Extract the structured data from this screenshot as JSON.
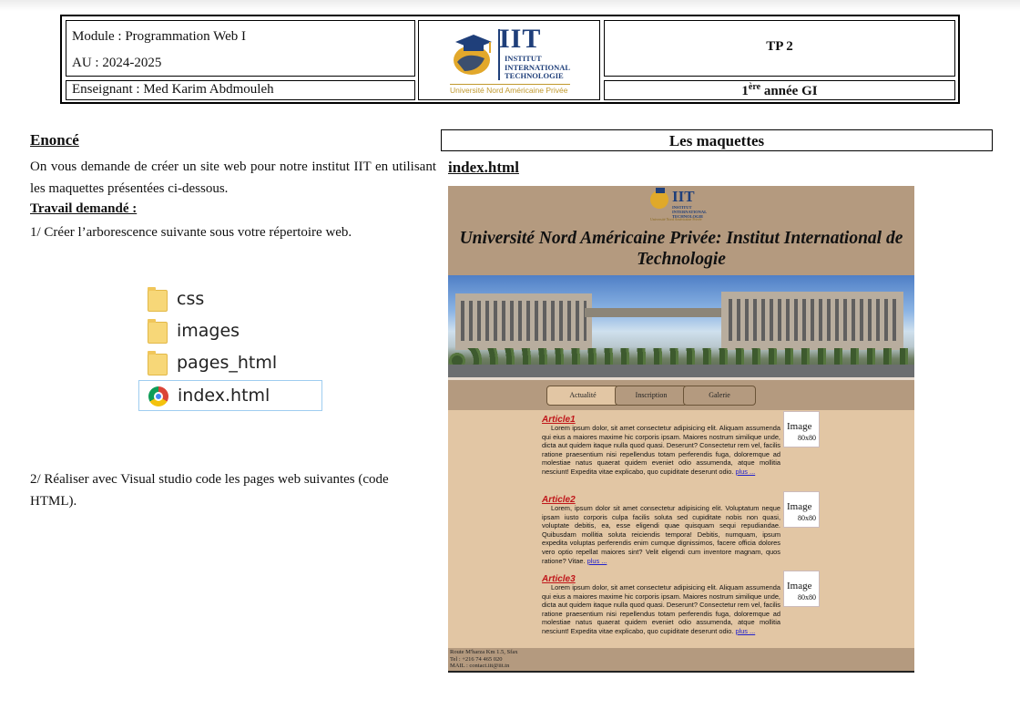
{
  "header": {
    "module": "Module : Programmation Web I",
    "au": "AU : 2024-2025",
    "enseignant": "Enseignant : Med Karim Abdmouleh",
    "tp": "TP 2",
    "annee_num": "1",
    "annee_sup": "ère",
    "annee_rest": " année GI",
    "logo": {
      "acronym": "IIT",
      "line1": "INSTITUT",
      "line2": "INTERNATIONAL",
      "line3": "TECHNOLOGIE",
      "university": "Université Nord Américaine Privée"
    }
  },
  "enonce": {
    "title": "Enoncé",
    "text": "On vous demande de créer un site web pour notre institut IIT en utilisant les maquettes présentées ci-dessous.",
    "travail_title": "Travail demandé :",
    "step1": "1/ Créer l’arborescence suivante sous votre répertoire web.",
    "step2": "2/ Réaliser avec Visual studio code les pages web suivantes (code HTML)."
  },
  "tree": [
    {
      "label": "css",
      "icon": "folder-icon"
    },
    {
      "label": "images",
      "icon": "folder-icon"
    },
    {
      "label": "pages_html",
      "icon": "folder-icon"
    },
    {
      "label": "index.html",
      "icon": "chrome-icon"
    }
  ],
  "maquettes": {
    "title": "Les maquettes",
    "file_label": "index.html"
  },
  "mockup": {
    "logo_acronym": "IIT",
    "logo_sub1": "INSTITUT",
    "logo_sub2": "INTERNATIONAL",
    "logo_sub3": "TECHNOLOGIE",
    "logo_univ": "Université Nord Américaine Privée",
    "title": "Université Nord Américaine Privée: Institut International de Technologie",
    "nav": [
      "Actualité",
      "Inscription",
      "Galerie"
    ],
    "articles": [
      {
        "title": "Article1",
        "body": "Lorem ipsum dolor, sit amet consectetur adipisicing elit. Aliquam assumenda qui eius a maiores maxime hic corporis ipsam. Maiores nostrum similique unde, dicta aut quidem itaque nulla quod quasi. Deserunt? Consectetur rem vel, facilis ratione praesentium nisi repellendus totam perferendis fuga, doloremque ad molestiae natus quaerat quidem eveniet odio assumenda, atque mollitia nesciunt! Expedita vitae explicabo, quo cupiditate deserunt odio.",
        "more": "plus ..."
      },
      {
        "title": "Article2",
        "body": "Lorem, ipsum dolor sit amet consectetur adipisicing elit. Voluptatum neque ipsam iusto corporis culpa facilis soluta sed cupiditate nobis non quasi, voluptate debitis, ea, esse eligendi quae quisquam sequi repudiandae. Quibusdam mollitia soluta reiciendis tempora! Debitis, numquam, ipsum expedita voluptas perferendis enim cumque dignissimos, facere officia dolores vero optio repellat maiores sint? Velit eligendi cum inventore magnam, quos ratione? Vitae.",
        "more": "plus ..."
      },
      {
        "title": "Article3",
        "body": "Lorem ipsum dolor, sit amet consectetur adipisicing elit. Aliquam assumenda qui eius a maiores maxime hic corporis ipsam. Maiores nostrum similique unde, dicta aut quidem itaque nulla quod quasi. Deserunt? Consectetur rem vel, facilis ratione praesentium nisi repellendus totam perferendis fuga, doloremque ad molestiae natus quaerat quidem eveniet odio assumenda, atque mollitia nesciunt! Expedita vitae explicabo, quo cupiditate deserunt odio.",
        "more": "plus ..."
      }
    ],
    "image_placeholder": "Image",
    "image_size": "80x80",
    "footer": [
      "Route M'harza Km 1.5, Sfax",
      "Tel : +216 74 465 020",
      "MAIL : contact.iit@iit.tn"
    ]
  }
}
